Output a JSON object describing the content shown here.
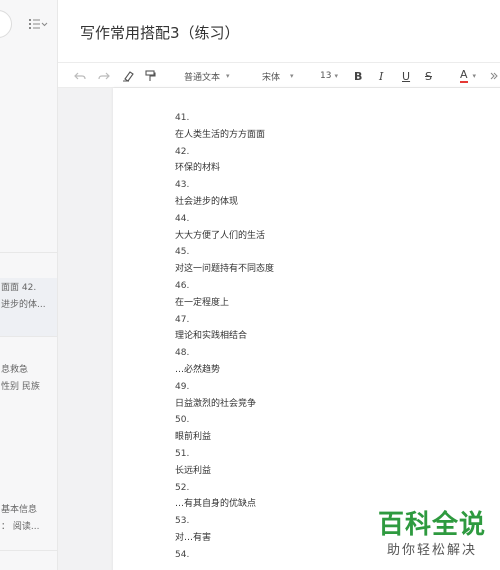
{
  "sidebar": {
    "snippets": [
      {
        "line1": "面面 42.",
        "line2": "进步的体..."
      },
      {
        "line1": "息救急",
        "line2": "性别 民族"
      },
      {
        "line1": "基本信息",
        "line2": "：  阅读..."
      }
    ]
  },
  "header": {
    "title": "写作常用搭配3（练习）"
  },
  "toolbar": {
    "paragraph_style": "普通文本",
    "font_family": "宋体",
    "font_size": "13",
    "bold": "B",
    "italic": "I",
    "underline": "U",
    "strike": "S",
    "font_color": "A",
    "font_color_value": "#e53935",
    "icons": [
      "undo-icon",
      "redo-icon",
      "clear-format-icon",
      "format-painter-icon"
    ]
  },
  "document": {
    "lines": [
      "41.",
      "在人类生活的方方面面",
      "42.",
      "环保的材料",
      "43.",
      "社会进步的体现",
      "44.",
      "大大方便了人们的生活",
      "45.",
      "对这一问题持有不同态度",
      "46.",
      "在一定程度上",
      "47.",
      "理论和实践相结合",
      "48.",
      "…必然趋势",
      "49.",
      "日益激烈的社会竞争",
      "50.",
      "眼前利益",
      "51.",
      "长远利益",
      "52.",
      "…有其自身的优缺点",
      "53.",
      "对…有害",
      "54."
    ]
  },
  "watermark": {
    "main": "百科全说",
    "sub": "助你轻松解决",
    "color": "#2e9a3f"
  }
}
